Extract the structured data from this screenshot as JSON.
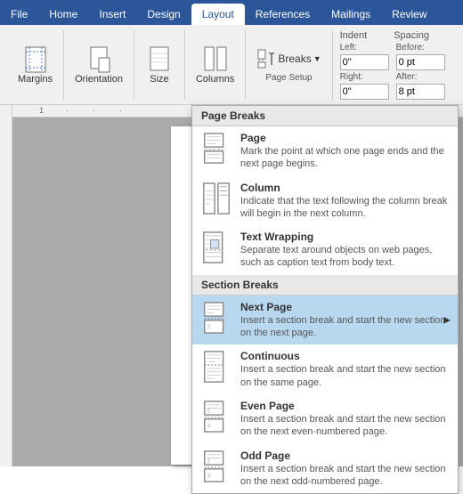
{
  "tabs": [
    {
      "id": "file",
      "label": "File"
    },
    {
      "id": "home",
      "label": "Home"
    },
    {
      "id": "insert",
      "label": "Insert"
    },
    {
      "id": "design",
      "label": "Design"
    },
    {
      "id": "layout",
      "label": "Layout",
      "active": true
    },
    {
      "id": "references",
      "label": "References"
    },
    {
      "id": "mailings",
      "label": "Mailings"
    },
    {
      "id": "review",
      "label": "Review"
    }
  ],
  "ribbon": {
    "groups": [
      {
        "label": "Margins",
        "id": "margins"
      },
      {
        "label": "Orientation",
        "id": "orientation"
      },
      {
        "label": "Size",
        "id": "size"
      },
      {
        "label": "Columns",
        "id": "columns"
      }
    ],
    "group_label": "Page Setup",
    "breaks_label": "Breaks",
    "indent_label": "Indent",
    "spacing_label": "Spacing"
  },
  "dropdown": {
    "pageBreaksHeader": "Page Breaks",
    "sectionBreaksHeader": "Section Breaks",
    "items": [
      {
        "id": "page",
        "title": "Page",
        "desc": "Mark the point at which one page ends and the next page begins.",
        "active": false
      },
      {
        "id": "column",
        "title": "Column",
        "desc": "Indicate that the text following the column break will begin in the next column.",
        "active": false
      },
      {
        "id": "text-wrapping",
        "title": "Text Wrapping",
        "desc": "Separate text around objects on web pages, such as caption text from body text.",
        "active": false
      },
      {
        "id": "next-page",
        "title": "Next Page",
        "desc": "Insert a section break and start the new section on the next page.",
        "active": true
      },
      {
        "id": "continuous",
        "title": "Continuous",
        "desc": "Insert a section break and start the new section on the same page.",
        "active": false
      },
      {
        "id": "even-page",
        "title": "Even Page",
        "desc": "Insert a section break and start the new section on the next even-numbered page.",
        "active": false
      },
      {
        "id": "odd-page",
        "title": "Odd Page",
        "desc": "Insert a section break and start the new section on the next odd-numbered page.",
        "active": false
      }
    ]
  }
}
